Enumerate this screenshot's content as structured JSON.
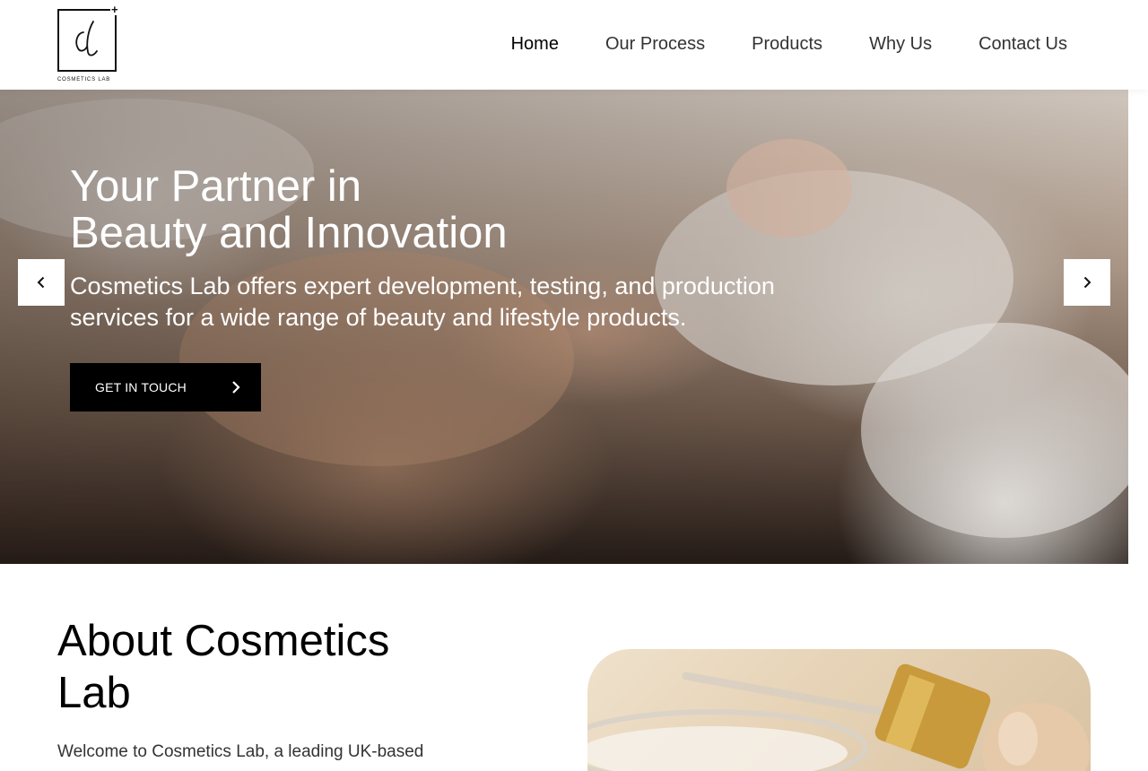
{
  "brand": {
    "logo_mark": "cl",
    "logo_text": "COSMETICS LAB",
    "logo_plus": "+"
  },
  "nav": {
    "items": [
      {
        "label": "Home",
        "active": true
      },
      {
        "label": "Our Process",
        "active": false
      },
      {
        "label": "Products",
        "active": false
      },
      {
        "label": "Why Us",
        "active": false
      },
      {
        "label": "Contact Us",
        "active": false
      }
    ]
  },
  "hero": {
    "title_line1": "Your Partner in",
    "title_line2": "Beauty and Innovation",
    "subtitle": "Cosmetics Lab offers expert development, testing, and production services for a wide range of beauty and lifestyle products.",
    "cta_label": "GET IN TOUCH",
    "prev_icon": "chevron-left-icon",
    "next_icon": "chevron-right-icon"
  },
  "about": {
    "title": "About Cosmetics Lab",
    "intro": "Welcome to Cosmetics Lab, a leading UK-based"
  },
  "colors": {
    "cta_background": "#000000",
    "cta_text": "#ffffff",
    "nav_text": "#333333"
  }
}
